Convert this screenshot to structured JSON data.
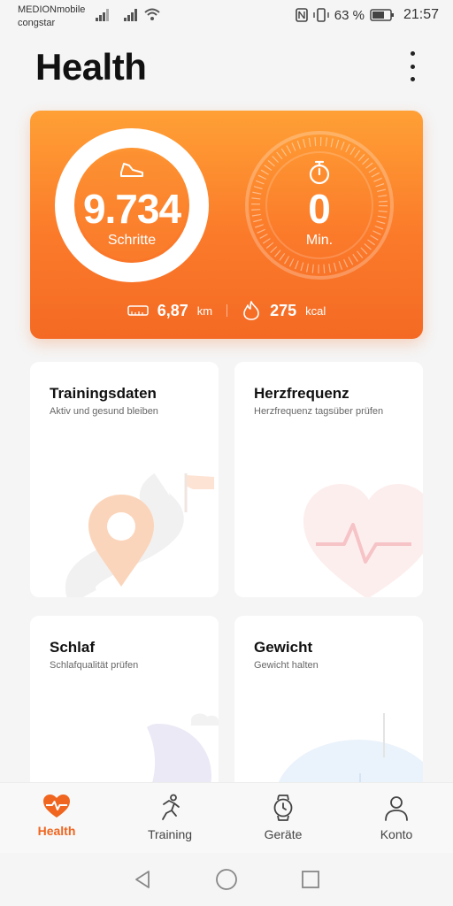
{
  "status_bar": {
    "carrier_1": "MEDIONmobile",
    "carrier_2": "congstar",
    "battery": "63 %",
    "time": "21:57"
  },
  "header": {
    "title": "Health"
  },
  "summary": {
    "steps_value": "9.734",
    "steps_label": "Schritte",
    "active_value": "0",
    "active_label": "Min.",
    "distance_value": "6,87",
    "distance_unit": "km",
    "calories_value": "275",
    "calories_unit": "kcal"
  },
  "tiles": [
    {
      "title": "Trainingsdaten",
      "subtitle": "Aktiv und gesund bleiben"
    },
    {
      "title": "Herzfrequenz",
      "subtitle": "Herzfrequenz tagsüber prüfen"
    },
    {
      "title": "Schlaf",
      "subtitle": "Schlafqualität prüfen"
    },
    {
      "title": "Gewicht",
      "subtitle": "Gewicht halten"
    }
  ],
  "bottom_nav": [
    {
      "label": "Health",
      "icon": "heart-pulse-icon",
      "active": true
    },
    {
      "label": "Training",
      "icon": "runner-icon",
      "active": false
    },
    {
      "label": "Geräte",
      "icon": "watch-icon",
      "active": false
    },
    {
      "label": "Konto",
      "icon": "person-icon",
      "active": false
    }
  ],
  "colors": {
    "accent": "#f0651f",
    "card_top": "#ffa035",
    "card_bottom": "#f46a24"
  }
}
